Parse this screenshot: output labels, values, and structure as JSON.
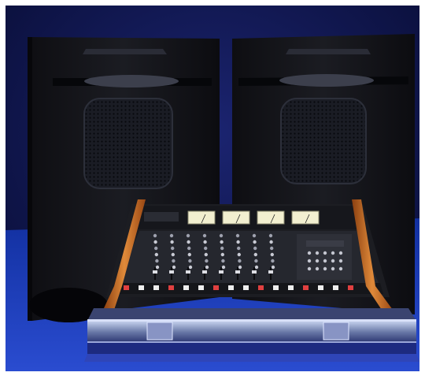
{
  "scene": {
    "subject": "stereo-speakers-and-mixing-console",
    "mixer": {
      "channel_count": 8,
      "vu_meter_count": 4,
      "brand_text": "",
      "panel_text": ""
    },
    "colors": {
      "background_dark": "#0a1248",
      "floor_blue": "#1b2fa8",
      "cabinet_black": "#141416",
      "wood_handles": "#d07a2a",
      "vu_meter_face": "#f2efd0",
      "console_panel": "#23252b"
    }
  }
}
